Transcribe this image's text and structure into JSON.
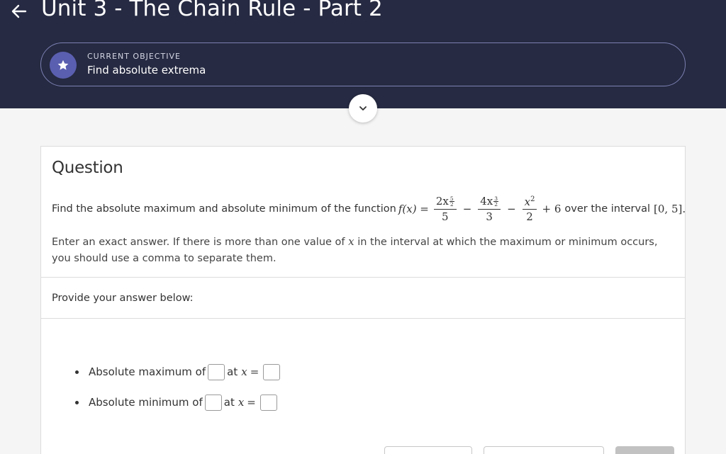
{
  "header": {
    "title": "Unit 3 - The Chain Rule - Part 2",
    "objective_label": "CURRENT OBJECTIVE",
    "objective_text": "Find absolute extrema"
  },
  "question": {
    "heading": "Question",
    "prompt_prefix": "Find the absolute maximum and absolute minimum of the function",
    "prompt_suffix": "over the interval",
    "interval": "[0, 5].",
    "instructions_1": "Enter an exact answer. If there is more than one value of",
    "instructions_var": "x",
    "instructions_2": "in the interval at which the maximum or minimum occurs, you should use a comma to separate them.",
    "provide_label": "Provide your answer below:"
  },
  "math": {
    "fx": "f(x) =",
    "t1_coef": "2x",
    "t1_exp_num": "5",
    "t1_exp_den": "2",
    "t1_den": "5",
    "op1": "−",
    "t2_coef": "4x",
    "t2_exp_num": "3",
    "t2_exp_den": "2",
    "t2_den": "3",
    "op2": "−",
    "t3_base": "x",
    "t3_exp": "2",
    "t3_den": "2",
    "tail": "+ 6"
  },
  "answers": {
    "max_label": "Absolute maximum of",
    "min_label": "Absolute minimum of",
    "at_label": "at",
    "var": "x",
    "equals": "="
  },
  "colors": {
    "header_bg": "#262a42",
    "accent": "#5b5fb0",
    "objective_border": "#7c80b3"
  }
}
